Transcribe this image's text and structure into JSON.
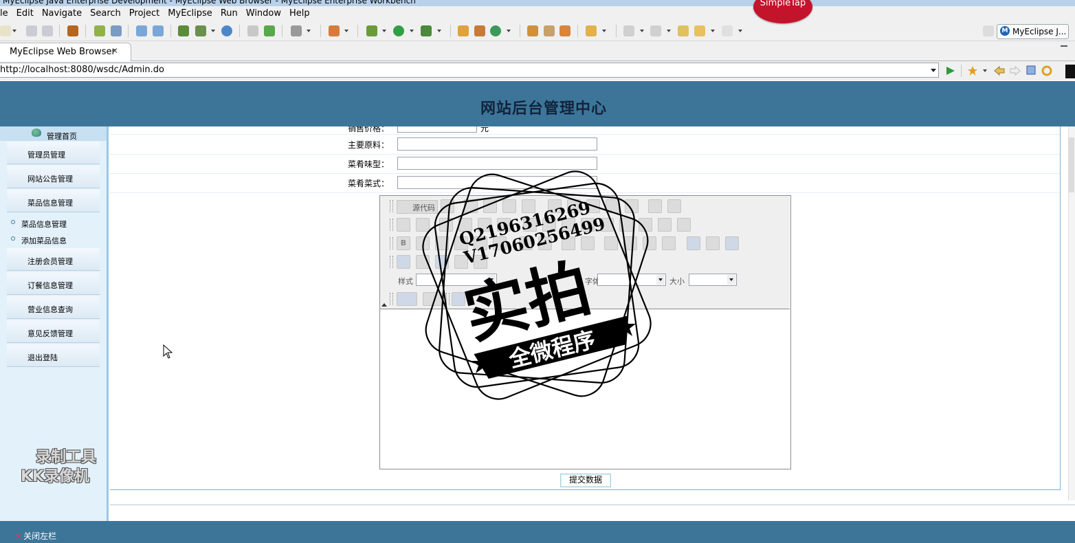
{
  "window": {
    "title": "MyEclipse Java Enterprise Development - MyEclipse Web Browser - MyEclipse Enterprise Workbench"
  },
  "overlay": {
    "simpletap": "SimpleTap"
  },
  "menu": [
    "le",
    "Edit",
    "Navigate",
    "Search",
    "Project",
    "MyEclipse",
    "Run",
    "Window",
    "Help"
  ],
  "perspective": {
    "label": "MyEclipse J...",
    "badge": "M"
  },
  "editor_tab": {
    "label": "MyEclipse Web Browser",
    "close": "✕"
  },
  "browser": {
    "url": "http://localhost:8080/wsdc/Admin.do"
  },
  "page": {
    "title": "网站后台管理中心"
  },
  "sidebar": {
    "home": "管理首页",
    "items": [
      "管理员管理",
      "网站公告管理",
      "菜品信息管理"
    ],
    "subitems": [
      "菜品信息管理",
      "添加菜品信息"
    ],
    "items2": [
      "注册会员管理",
      "订餐信息管理",
      "营业信息查询",
      "意见反馈管理",
      "退出登陆"
    ],
    "close_left": "关闭左栏",
    "close_mark": "×"
  },
  "form": {
    "partial_label": "销售价格：",
    "price_unit": "元",
    "fields": [
      {
        "label": "主要原料：",
        "value": ""
      },
      {
        "label": "菜肴味型：",
        "value": ""
      },
      {
        "label": "菜肴菜式：",
        "value": ""
      }
    ],
    "editor": {
      "source_label": "源代码",
      "style_label": "样式",
      "font_label": "字体",
      "size_label": "大小"
    },
    "submit": "提交数据"
  },
  "watermarks": {
    "kk_line1": "录制工具",
    "kk_line2": "KK录像机",
    "stamp_line1": "Q2196316269",
    "stamp_line2": "V17060256499",
    "stamp_big": "实拍",
    "stamp_banner": "全微程序"
  },
  "colors": {
    "header_blue": "#3d7599",
    "sidebar_bg": "#e3f1fb",
    "accent_red": "#c4142c"
  }
}
